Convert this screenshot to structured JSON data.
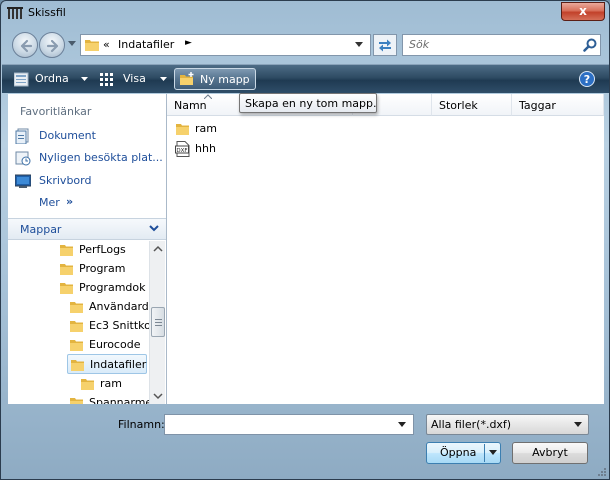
{
  "window": {
    "title": "Skissfil",
    "close_label": "x"
  },
  "address": {
    "chevrons": "«",
    "path_segment": "Indatafiler",
    "arrow": "►"
  },
  "search": {
    "placeholder": "Sök"
  },
  "toolbar": {
    "organize_label": "Ordna",
    "views_label": "Visa",
    "new_folder_label": "Ny mapp",
    "help_label": "?"
  },
  "tooltip": {
    "text": "Skapa en ny tom mapp."
  },
  "favorites": {
    "header": "Favoritlänkar",
    "items": [
      {
        "label": "Dokument",
        "icon": "documents-icon"
      },
      {
        "label": "Nyligen besökta plat...",
        "icon": "recent-places-icon"
      },
      {
        "label": "Skrivbord",
        "icon": "desktop-icon"
      }
    ],
    "more_label": "Mer",
    "more_chevron": "»"
  },
  "folders": {
    "header": "Mappar",
    "items": [
      {
        "label": "PerfLogs",
        "level": 0
      },
      {
        "label": "Program",
        "level": 0
      },
      {
        "label": "Programdok",
        "level": 0
      },
      {
        "label": "Användard",
        "level": 1
      },
      {
        "label": "Ec3 Snittko",
        "level": 1
      },
      {
        "label": "Eurocode",
        "level": 1
      },
      {
        "label": "Indatafiler",
        "level": 1,
        "selected": true
      },
      {
        "label": "ram",
        "level": 2
      },
      {
        "label": "Spannarme",
        "level": 1
      }
    ]
  },
  "columns": {
    "name": "Namn",
    "date": "",
    "size": "Storlek",
    "tags": "Taggar"
  },
  "files": [
    {
      "name": "ram",
      "type": "folder",
      "icon": "folder-icon"
    },
    {
      "name": "hhh",
      "type": "dxf",
      "icon": "dxf-file-icon",
      "icon_text": "DXF"
    }
  ],
  "bottom": {
    "filename_label": "Filnamn:",
    "filename_value": "",
    "filter_value": "Alla filer(*.dxf)",
    "open_label": "Öppna",
    "cancel_label": "Avbryt"
  },
  "colors": {
    "accent": "#1e4e9a",
    "toolbar": "#2e4b63",
    "close": "#c2412a",
    "selection": "#d9ebf9"
  }
}
